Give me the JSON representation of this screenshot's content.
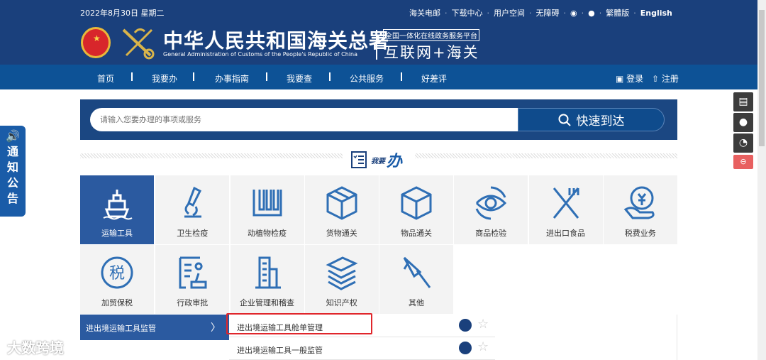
{
  "header": {
    "date": "2022年8月30日  星期二",
    "links": [
      "海关电邮",
      "下载中心",
      "用户空间",
      "无障碍",
      "繁體版",
      "English"
    ],
    "title_cn": "中华人民共和国海关总署",
    "title_en": "General Administration of Customs of the People's Republic of China",
    "platform": "全国一体化在线政务服务平台",
    "platform_sub": "互联网+海关"
  },
  "nav": {
    "items": [
      "首页",
      "我要办",
      "办事指南",
      "我要查",
      "公共服务",
      "好差评"
    ],
    "login": "登录",
    "register": "注册"
  },
  "search": {
    "placeholder": "请输入您要办理的事项或服务",
    "button": "快速到达"
  },
  "section": {
    "prefix": "我要",
    "title": "办"
  },
  "grid": {
    "items": [
      "运输工具",
      "卫生检疫",
      "动植物检疫",
      "货物通关",
      "物品通关",
      "商品检验",
      "进出口食品",
      "税费业务",
      "加贸保税",
      "行政审批",
      "企业管理和稽查",
      "知识产权",
      "其他"
    ]
  },
  "submenu": {
    "category": "进出境运输工具监管",
    "items": [
      "进出境运输工具舱单管理",
      "进出境运输工具一般监管"
    ]
  },
  "notice": {
    "label": "通知公告"
  },
  "watermark": "大数跨境",
  "colors": {
    "header": "#1a407c",
    "nav": "#0d5296",
    "active": "#2b5aa0",
    "highlight": "#e0262b"
  }
}
